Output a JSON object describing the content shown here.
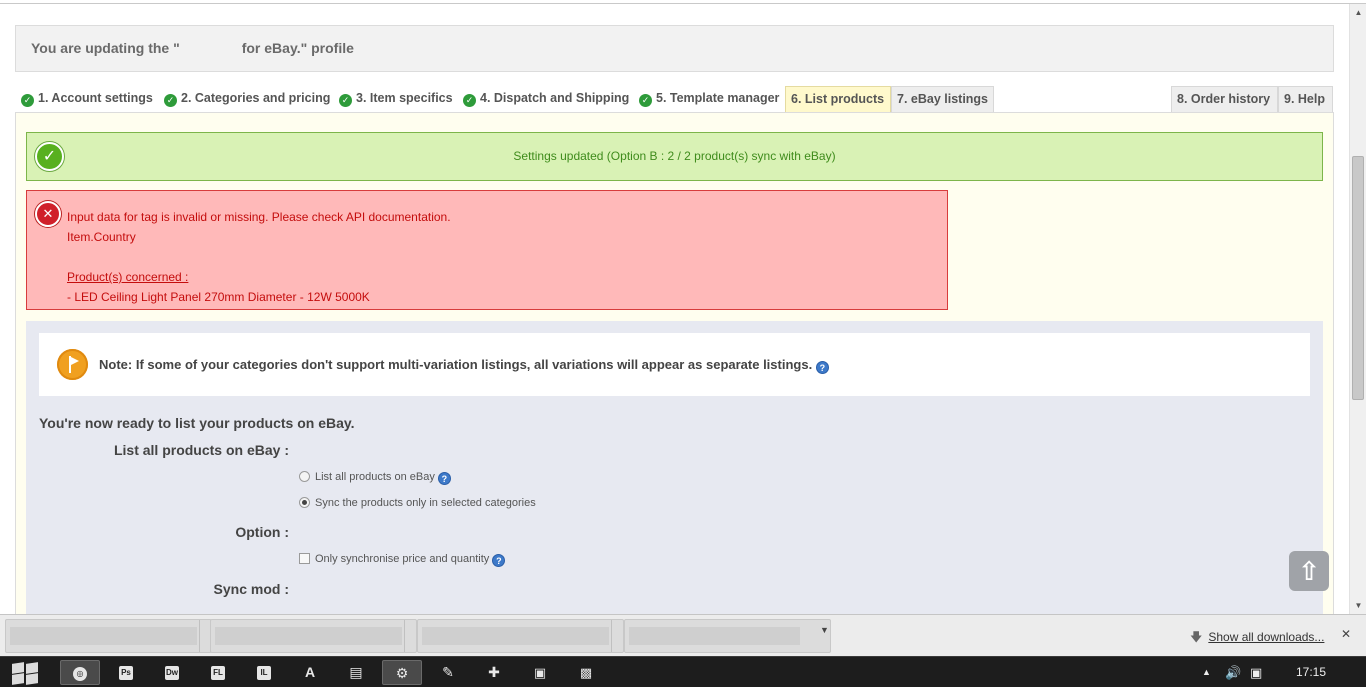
{
  "profile_header": {
    "prefix": "You are updating the \"",
    "suffix": "for eBay.\" profile"
  },
  "tabs": [
    {
      "label": "1. Account settings",
      "checked": true
    },
    {
      "label": "2. Categories and pricing",
      "checked": true
    },
    {
      "label": "3. Item specifics",
      "checked": true
    },
    {
      "label": "4. Dispatch and Shipping",
      "checked": true
    },
    {
      "label": "5. Template manager",
      "checked": true
    },
    {
      "label": "6. List products",
      "active": true
    },
    {
      "label": "7. eBay listings"
    },
    {
      "label": "8. Order history"
    },
    {
      "label": "9. Help"
    }
  ],
  "success": {
    "text": "Settings updated (Option B : 2 / 2 product(s) sync with eBay)"
  },
  "error": {
    "message": "Input data for tag is invalid or missing. Please check API documentation.",
    "field": "Item.Country",
    "products_heading": "Product(s) concerned :",
    "product": "- LED Ceiling Light Panel 270mm Diameter - 12W 5000K"
  },
  "note": {
    "text": "Note: If some of your categories don't support multi-variation listings, all variations will appear as separate listings."
  },
  "list_section": {
    "title": "You're now ready to list your products on eBay.",
    "list_all_label": "List all products on eBay :",
    "radio_all": "List all products on eBay",
    "radio_selected": "Sync the products only in selected categories",
    "selected_mode": "selected",
    "option_label": "Option :",
    "checkbox_price": "Only synchronise price and quantity",
    "checkbox_checked": false,
    "sync_mod_label": "Sync mod :"
  },
  "downloads": {
    "show_all": "Show all downloads..."
  },
  "taskbar": {
    "apps": [
      "chrome",
      "Ps",
      "Dw",
      "FL",
      "IL",
      "A",
      "files",
      "tool",
      "pen",
      "crop",
      "folder-a",
      "folder-b"
    ],
    "clock": "17:15"
  },
  "colors": {
    "success_bg": "#d9f2b5",
    "error_bg": "#ffb9b9",
    "active_tab": "#fff9cc",
    "panel_bg": "#fffeef",
    "list_bg": "#e7e9f1"
  }
}
